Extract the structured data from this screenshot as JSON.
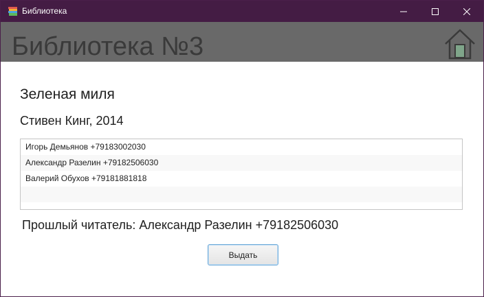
{
  "window": {
    "title": "Библиотека",
    "app_icon": "books-icon",
    "controls": [
      "minimize-icon",
      "maximize-icon",
      "close-icon"
    ]
  },
  "header": {
    "title": "Библиотека №3",
    "home_icon": "home-icon",
    "band_color": "#696969"
  },
  "book": {
    "title": "Зеленая миля",
    "meta": "Стивен Кинг, 2014"
  },
  "readers": [
    {
      "label": "Игорь Демьянов +79183002030"
    },
    {
      "label": "Александр Разелин +79182506030"
    },
    {
      "label": "Валерий Обухов +79181881818"
    }
  ],
  "previous_reader": "Прошлый читатель: Александр Разелин +79182506030",
  "actions": {
    "issue_label": "Выдать",
    "issue_border_color": "#6aa8d8"
  },
  "colors": {
    "titlebar": "#441c44",
    "text": "#1e1e1e"
  }
}
